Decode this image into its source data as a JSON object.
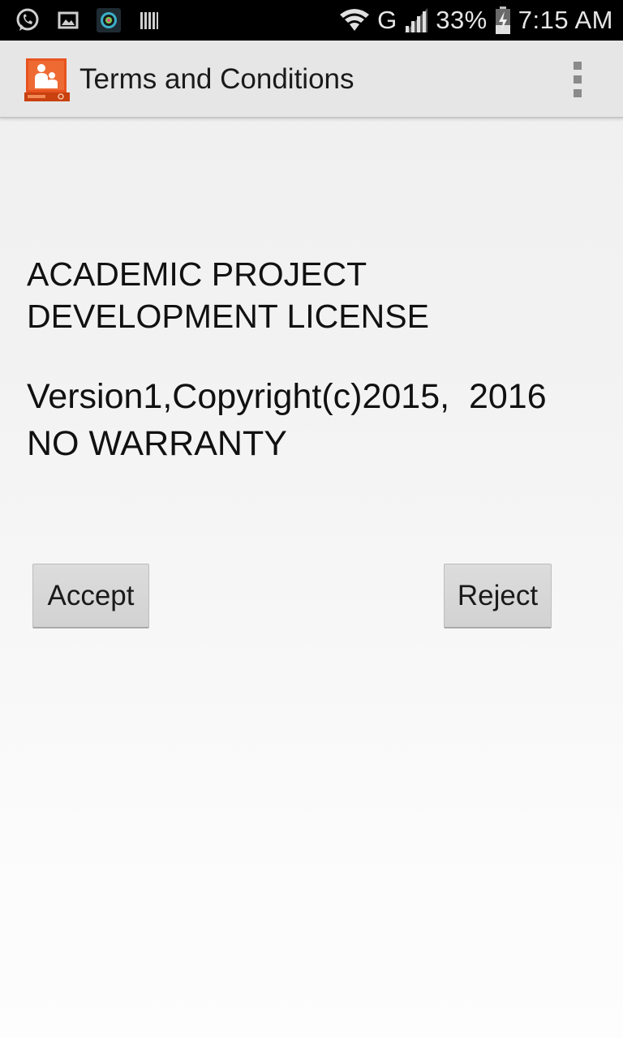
{
  "status_bar": {
    "left_icons": [
      "whatsapp-icon",
      "gallery-icon",
      "camera-app-icon",
      "barcode-icon"
    ],
    "network_type": "G",
    "battery_percent": "33%",
    "time": "7:15 AM"
  },
  "action_bar": {
    "title": "Terms and Conditions",
    "app_icon": "presentation-app-icon",
    "overflow_icon": "overflow-menu-icon"
  },
  "license": {
    "title_line1": "ACADEMIC PROJECT",
    "title_line2": "DEVELOPMENT LICENSE",
    "version_line": "Version1,Copyright(c)2015,  2016",
    "warranty_line": "NO WARRANTY"
  },
  "buttons": {
    "accept_label": "Accept",
    "reject_label": "Reject"
  },
  "colors": {
    "status_bar_bg": "#000000",
    "action_bar_bg": "#e6e6e6",
    "app_icon_orange": "#e8531f",
    "button_bg": "#d6d6d6"
  }
}
